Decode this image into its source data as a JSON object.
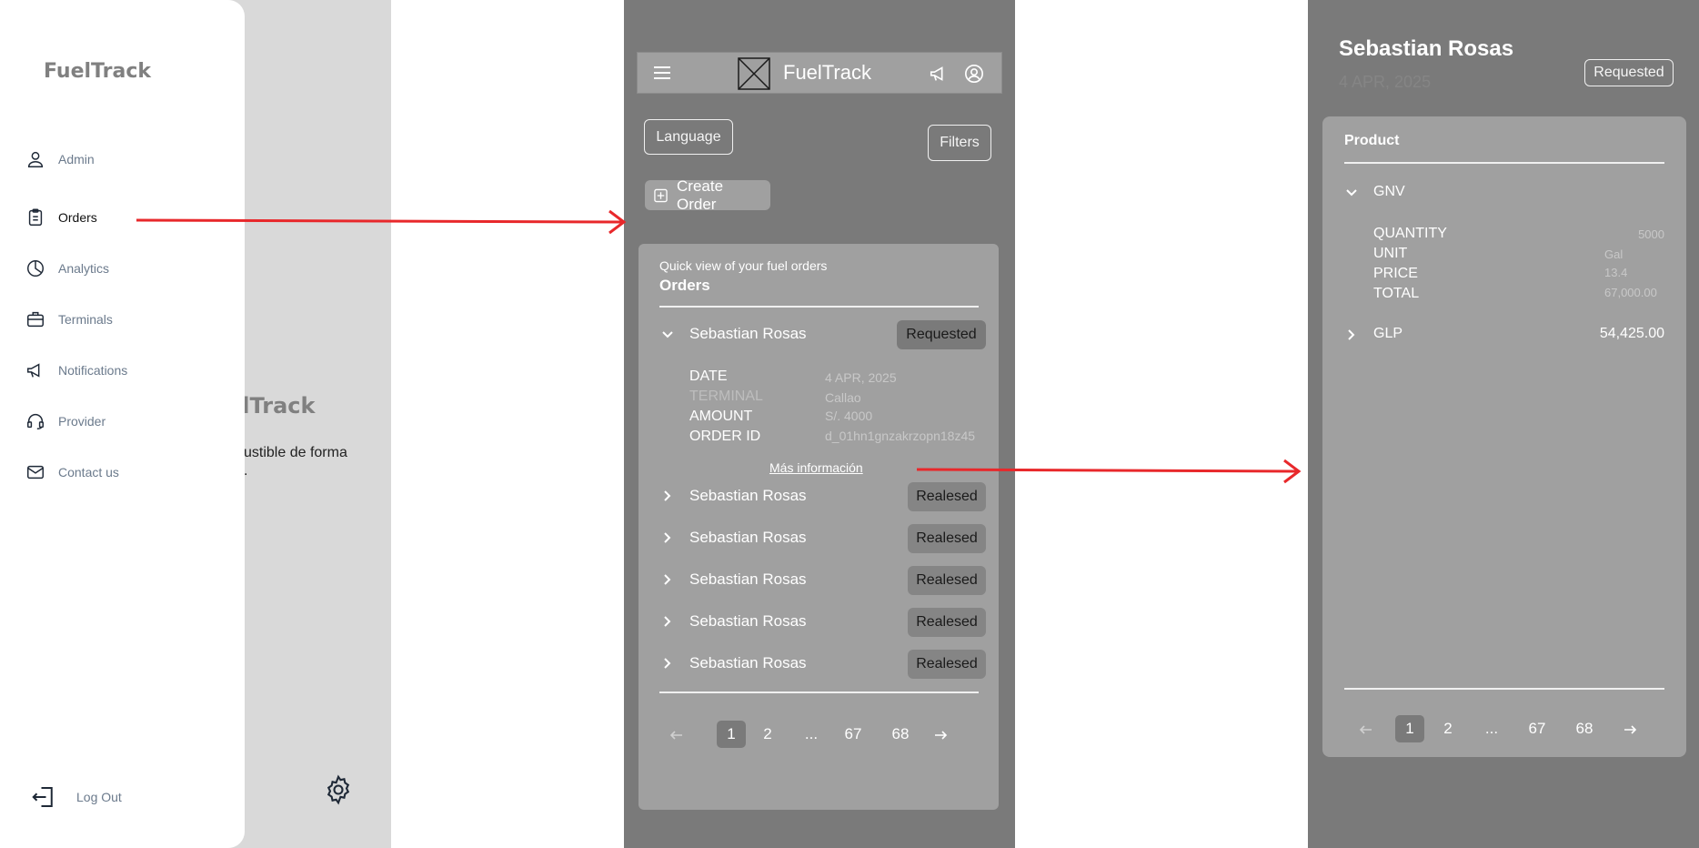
{
  "menu_screen": {
    "brand": "FuelTrack",
    "nav": [
      {
        "label": "Admin",
        "icon": "user-icon"
      },
      {
        "label": "Orders",
        "icon": "clipboard-icon"
      },
      {
        "label": "Analytics",
        "icon": "pie-chart-icon"
      },
      {
        "label": "Terminals",
        "icon": "briefcase-icon"
      },
      {
        "label": "Notifications",
        "icon": "megaphone-icon"
      },
      {
        "label": "Provider",
        "icon": "headset-icon"
      },
      {
        "label": "Contact us",
        "icon": "mail-icon"
      }
    ],
    "active_item": "Orders",
    "logout_label": "Log Out",
    "behind_brand": "elTrack",
    "behind_text_line1": "ustible de forma",
    "behind_text_line2": "."
  },
  "orders_screen": {
    "app_title": "FuelTrack",
    "language_label": "Language",
    "filters_label": "Filters",
    "create_order_label": "Create Order",
    "card_subtitle": "Quick view of your fuel orders",
    "card_title": "Orders",
    "expanded_order": {
      "name": "Sebastian Rosas",
      "status": "Requested",
      "fields": [
        {
          "label": "DATE",
          "value": "4 APR, 2025"
        },
        {
          "label": "TERMINAL",
          "value": "Callao"
        },
        {
          "label": "AMOUNT",
          "value": "S/. 4000"
        },
        {
          "label": "ORDER ID",
          "value": "d_01hn1gnzakrzopn18z45"
        }
      ],
      "more_info_link": "Más información"
    },
    "collapsed_orders": [
      {
        "name": "Sebastian Rosas",
        "status": "Realesed"
      },
      {
        "name": "Sebastian Rosas",
        "status": "Realesed"
      },
      {
        "name": "Sebastian Rosas",
        "status": "Realesed"
      },
      {
        "name": "Sebastian Rosas",
        "status": "Realesed"
      },
      {
        "name": "Sebastian Rosas",
        "status": "Realesed"
      }
    ],
    "pagination": {
      "pages": [
        "1",
        "2",
        "...",
        "67",
        "68"
      ],
      "current": "1"
    }
  },
  "detail_screen": {
    "name": "Sebastian Rosas",
    "date": "4 APR, 2025",
    "status": "Requested",
    "section_title": "Product",
    "products": [
      {
        "name": "GNV",
        "expanded": true,
        "fields": [
          {
            "label": "QUANTITY",
            "value": "5000"
          },
          {
            "label": "UNIT",
            "value": "Gal"
          },
          {
            "label": "PRICE",
            "value": "13.4"
          },
          {
            "label": "TOTAL",
            "value": "67,000.00"
          }
        ]
      },
      {
        "name": "GLP",
        "expanded": false,
        "total": "54,425.00"
      }
    ],
    "pagination": {
      "pages": [
        "1",
        "2",
        "...",
        "67",
        "68"
      ],
      "current": "1"
    }
  },
  "colors": {
    "arrow": "#e8282b",
    "panel_dark": "#7a7a7a",
    "panel_mid": "#a0a0a0",
    "drawer_bg": "#ffffff",
    "nav_text": "#6b7a8c"
  }
}
